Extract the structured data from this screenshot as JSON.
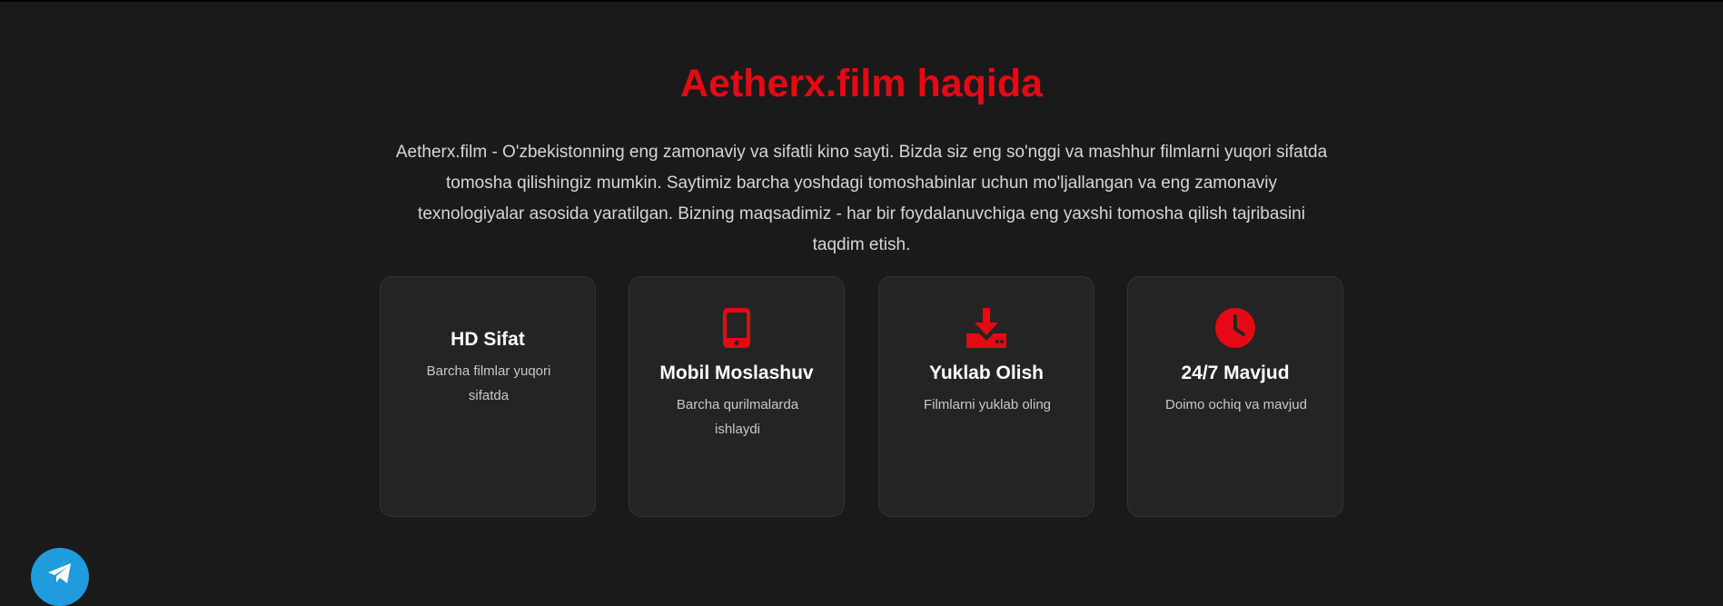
{
  "about": {
    "title": "Aetherx.film haqida",
    "description": "Aetherx.film - O'zbekistonning eng zamonaviy va sifatli kino sayti. Bizda siz eng so'nggi va mashhur filmlarni yuqori sifatda tomosha qilishingiz mumkin. Saytimiz barcha yoshdagi tomoshabinlar uchun mo'ljallangan va eng zamonaviy texnologiyalar asosida yaratilgan. Bizning maqsadimiz - har bir foydalanuvchiga eng yaxshi tomosha qilish tajribasini taqdim etish."
  },
  "features": [
    {
      "title": "HD Sifat",
      "text": "Barcha filmlar yuqori sifatda",
      "icon": "none"
    },
    {
      "title": "Mobil Moslashuv",
      "text": "Barcha qurilmalarda ishlaydi",
      "icon": "mobile-phone-icon"
    },
    {
      "title": "Yuklab Olish",
      "text": "Filmlarni yuklab oling",
      "icon": "download-icon"
    },
    {
      "title": "24/7 Mavjud",
      "text": "Doimo ochiq va mavjud",
      "icon": "clock-icon"
    }
  ],
  "floating": {
    "icon": "telegram-icon"
  },
  "colors": {
    "background": "#1a1a1a",
    "card": "#242424",
    "accent": "#e50914",
    "telegram": "#1f9bde"
  }
}
